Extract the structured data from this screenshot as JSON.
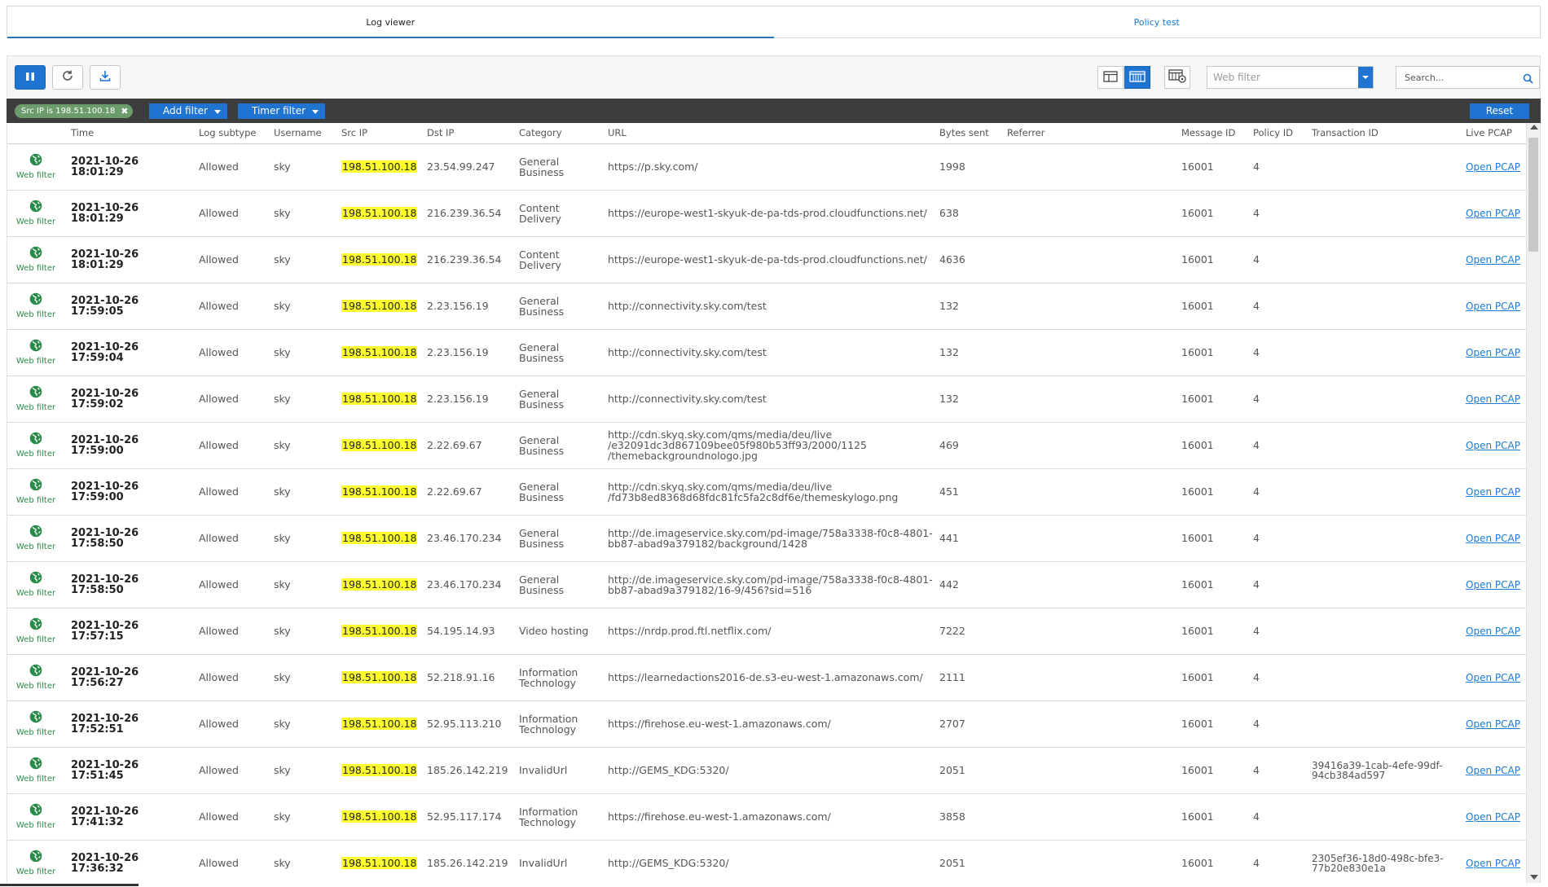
{
  "tabs": [
    {
      "label": "Log viewer",
      "active": true
    },
    {
      "label": "Policy test",
      "active": false
    }
  ],
  "toolbar": {
    "pause_icon": "pause-icon",
    "refresh_icon": "refresh-icon",
    "export_icon": "download-icon",
    "log_select_value": "Web filter",
    "search_placeholder": "Search..."
  },
  "filters": {
    "active_chip": "Src IP is 198.51.100.18",
    "add_filter_label": "Add filter",
    "timer_filter_label": "Timer filter",
    "reset_label": "Reset"
  },
  "colors": {
    "accent": "#1e74d0",
    "highlight": "#ffff2e",
    "webfilter_green": "#2a8a4a"
  },
  "table": {
    "columns": [
      "",
      "Time",
      "Log subtype",
      "Username",
      "Src IP",
      "Dst IP",
      "Category",
      "URL",
      "Bytes sent",
      "Referrer",
      "Message ID",
      "Policy ID",
      "Transaction ID",
      "Live PCAP"
    ],
    "rows": [
      {
        "type": "Web filter",
        "time": "2021-10-26 18:01:29",
        "subtype": "Allowed",
        "user": "sky",
        "src": "198.51.100.18",
        "dst": "23.54.99.247",
        "category": "General Business",
        "url": "https://p.sky.com/",
        "bytes": "1998",
        "referrer": "",
        "msg": "16001",
        "policy": "4",
        "txid": "",
        "pcap": "Open PCAP"
      },
      {
        "type": "Web filter",
        "time": "2021-10-26 18:01:29",
        "subtype": "Allowed",
        "user": "sky",
        "src": "198.51.100.18",
        "dst": "216.239.36.54",
        "category": "Content Delivery",
        "url": "https://europe-west1-skyuk-de-pa-tds-prod.cloudfunctions.net/",
        "bytes": "638",
        "referrer": "",
        "msg": "16001",
        "policy": "4",
        "txid": "",
        "pcap": "Open PCAP"
      },
      {
        "type": "Web filter",
        "time": "2021-10-26 18:01:29",
        "subtype": "Allowed",
        "user": "sky",
        "src": "198.51.100.18",
        "dst": "216.239.36.54",
        "category": "Content Delivery",
        "url": "https://europe-west1-skyuk-de-pa-tds-prod.cloudfunctions.net/",
        "bytes": "4636",
        "referrer": "",
        "msg": "16001",
        "policy": "4",
        "txid": "",
        "pcap": "Open PCAP"
      },
      {
        "type": "Web filter",
        "time": "2021-10-26 17:59:05",
        "subtype": "Allowed",
        "user": "sky",
        "src": "198.51.100.18",
        "dst": "2.23.156.19",
        "category": "General Business",
        "url": "http://connectivity.sky.com/test",
        "bytes": "132",
        "referrer": "",
        "msg": "16001",
        "policy": "4",
        "txid": "",
        "pcap": "Open PCAP"
      },
      {
        "type": "Web filter",
        "time": "2021-10-26 17:59:04",
        "subtype": "Allowed",
        "user": "sky",
        "src": "198.51.100.18",
        "dst": "2.23.156.19",
        "category": "General Business",
        "url": "http://connectivity.sky.com/test",
        "bytes": "132",
        "referrer": "",
        "msg": "16001",
        "policy": "4",
        "txid": "",
        "pcap": "Open PCAP"
      },
      {
        "type": "Web filter",
        "time": "2021-10-26 17:59:02",
        "subtype": "Allowed",
        "user": "sky",
        "src": "198.51.100.18",
        "dst": "2.23.156.19",
        "category": "General Business",
        "url": "http://connectivity.sky.com/test",
        "bytes": "132",
        "referrer": "",
        "msg": "16001",
        "policy": "4",
        "txid": "",
        "pcap": "Open PCAP"
      },
      {
        "type": "Web filter",
        "time": "2021-10-26 17:59:00",
        "subtype": "Allowed",
        "user": "sky",
        "src": "198.51.100.18",
        "dst": "2.22.69.67",
        "category": "General Business",
        "url": "http://cdn.skyq.sky.com/qms/media/deu/live /e32091dc3d867109bee05f980b53ff93/2000/1125 /themebackgroundnologo.jpg",
        "bytes": "469",
        "referrer": "",
        "msg": "16001",
        "policy": "4",
        "txid": "",
        "pcap": "Open PCAP"
      },
      {
        "type": "Web filter",
        "time": "2021-10-26 17:59:00",
        "subtype": "Allowed",
        "user": "sky",
        "src": "198.51.100.18",
        "dst": "2.22.69.67",
        "category": "General Business",
        "url": "http://cdn.skyq.sky.com/qms/media/deu/live /fd73b8ed8368d68fdc81fc5fa2c8df6e/themeskylogo.png",
        "bytes": "451",
        "referrer": "",
        "msg": "16001",
        "policy": "4",
        "txid": "",
        "pcap": "Open PCAP"
      },
      {
        "type": "Web filter",
        "time": "2021-10-26 17:58:50",
        "subtype": "Allowed",
        "user": "sky",
        "src": "198.51.100.18",
        "dst": "23.46.170.234",
        "category": "General Business",
        "url": "http://de.imageservice.sky.com/pd-image/758a3338-f0c8-4801-bb87-abad9a379182/background/1428",
        "bytes": "441",
        "referrer": "",
        "msg": "16001",
        "policy": "4",
        "txid": "",
        "pcap": "Open PCAP"
      },
      {
        "type": "Web filter",
        "time": "2021-10-26 17:58:50",
        "subtype": "Allowed",
        "user": "sky",
        "src": "198.51.100.18",
        "dst": "23.46.170.234",
        "category": "General Business",
        "url": "http://de.imageservice.sky.com/pd-image/758a3338-f0c8-4801-bb87-abad9a379182/16-9/456?sid=516",
        "bytes": "442",
        "referrer": "",
        "msg": "16001",
        "policy": "4",
        "txid": "",
        "pcap": "Open PCAP"
      },
      {
        "type": "Web filter",
        "time": "2021-10-26 17:57:15",
        "subtype": "Allowed",
        "user": "sky",
        "src": "198.51.100.18",
        "dst": "54.195.14.93",
        "category": "Video hosting",
        "url": "https://nrdp.prod.ftl.netflix.com/",
        "bytes": "7222",
        "referrer": "",
        "msg": "16001",
        "policy": "4",
        "txid": "",
        "pcap": "Open PCAP"
      },
      {
        "type": "Web filter",
        "time": "2021-10-26 17:56:27",
        "subtype": "Allowed",
        "user": "sky",
        "src": "198.51.100.18",
        "dst": "52.218.91.16",
        "category": "Information Technology",
        "url": "https://learnedactions2016-de.s3-eu-west-1.amazonaws.com/",
        "bytes": "2111",
        "referrer": "",
        "msg": "16001",
        "policy": "4",
        "txid": "",
        "pcap": "Open PCAP"
      },
      {
        "type": "Web filter",
        "time": "2021-10-26 17:52:51",
        "subtype": "Allowed",
        "user": "sky",
        "src": "198.51.100.18",
        "dst": "52.95.113.210",
        "category": "Information Technology",
        "url": "https://firehose.eu-west-1.amazonaws.com/",
        "bytes": "2707",
        "referrer": "",
        "msg": "16001",
        "policy": "4",
        "txid": "",
        "pcap": "Open PCAP"
      },
      {
        "type": "Web filter",
        "time": "2021-10-26 17:51:45",
        "subtype": "Allowed",
        "user": "sky",
        "src": "198.51.100.18",
        "dst": "185.26.142.219",
        "category": "InvalidUrl",
        "url": "http://GEMS_KDG:5320/",
        "bytes": "2051",
        "referrer": "",
        "msg": "16001",
        "policy": "4",
        "txid": "39416a39-1cab-4efe-99df-94cb384ad597",
        "pcap": "Open PCAP"
      },
      {
        "type": "Web filter",
        "time": "2021-10-26 17:41:32",
        "subtype": "Allowed",
        "user": "sky",
        "src": "198.51.100.18",
        "dst": "52.95.117.174",
        "category": "Information Technology",
        "url": "https://firehose.eu-west-1.amazonaws.com/",
        "bytes": "3858",
        "referrer": "",
        "msg": "16001",
        "policy": "4",
        "txid": "",
        "pcap": "Open PCAP"
      },
      {
        "type": "Web filter",
        "time": "2021-10-26 17:36:32",
        "subtype": "Allowed",
        "user": "sky",
        "src": "198.51.100.18",
        "dst": "185.26.142.219",
        "category": "InvalidUrl",
        "url": "http://GEMS_KDG:5320/",
        "bytes": "2051",
        "referrer": "",
        "msg": "16001",
        "policy": "4",
        "txid": "2305ef36-18d0-498c-bfe3-77b20e830e1a",
        "pcap": "Open PCAP"
      }
    ]
  }
}
